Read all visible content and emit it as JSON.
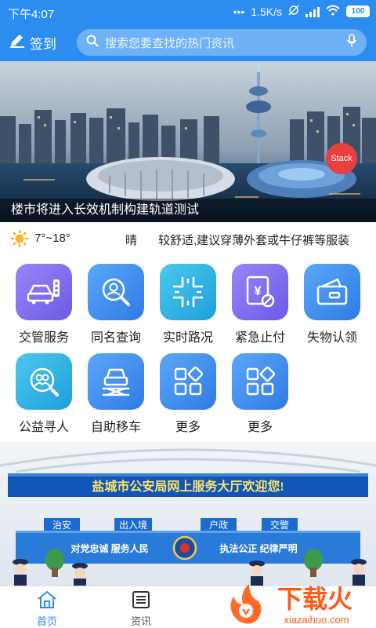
{
  "status_bar": {
    "time": "下午4:07",
    "speed": "1.5K/s",
    "battery": "100"
  },
  "header": {
    "checkin_label": "签到",
    "search_placeholder": "搜索您要查找的热门资讯"
  },
  "banner": {
    "caption": "楼市将进入长效机制构建轨道测试",
    "stack_label": "Stack"
  },
  "weather": {
    "temperature": "7°~18°",
    "condition": "晴",
    "advice": "较舒适,建议穿薄外套或牛仔裤等服装"
  },
  "services": [
    {
      "label": "交管服务",
      "icon": "car-traffic-icon",
      "color": "#7a6cf0"
    },
    {
      "label": "同名查询",
      "icon": "person-search-icon",
      "color": "#3b8df0"
    },
    {
      "label": "实时路况",
      "icon": "road-cross-icon",
      "color": "#2fb4e4"
    },
    {
      "label": "紧急止付",
      "icon": "payment-stop-icon",
      "color": "#7a6cf0"
    },
    {
      "label": "失物认领",
      "icon": "wallet-icon",
      "color": "#3b8df0"
    },
    {
      "label": "公益寻人",
      "icon": "people-search-icon",
      "color": "#2fb4e4"
    },
    {
      "label": "自助移车",
      "icon": "car-move-icon",
      "color": "#3b8df0"
    },
    {
      "label": "更多",
      "icon": "apps-icon",
      "color": "#3b8df0"
    },
    {
      "label": "更多",
      "icon": "apps-icon",
      "color": "#3b8df0"
    }
  ],
  "hall": {
    "title": "盐城市公安局网上服务大厅欢迎您!",
    "windows": [
      "治安",
      "出入境",
      "户政",
      "交警"
    ],
    "slogan_left": "对党忠诚 服务人民",
    "slogan_right": "执法公正 纪律严明"
  },
  "tabs": [
    {
      "label": "首页",
      "icon": "home-icon",
      "active": true
    },
    {
      "label": "资讯",
      "icon": "news-icon",
      "active": false
    }
  ],
  "watermark": {
    "text": "下载火",
    "url": "xiazaihuo.com"
  }
}
